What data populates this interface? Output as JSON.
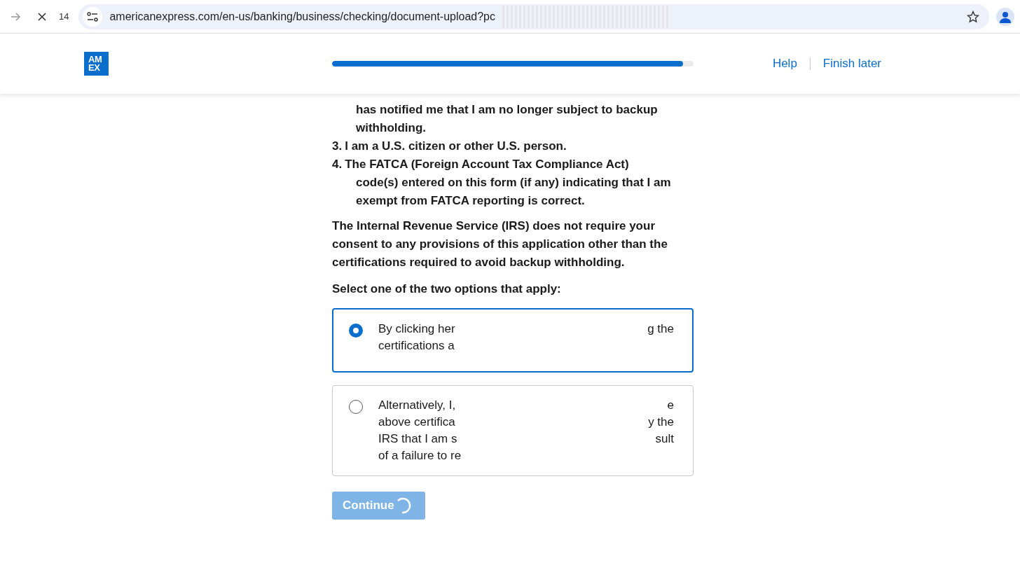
{
  "browser": {
    "tab_count": "14",
    "url": "americanexpress.com/en-us/banking/business/checking/document-upload?pc",
    "bookmarked": false
  },
  "header": {
    "logo": [
      "AM",
      "EX"
    ],
    "progress": {
      "level": 0.97
    },
    "links": [
      {
        "label": "Help"
      },
      {
        "label": "Finish later"
      }
    ]
  },
  "certifications": [
    {
      "text": "has notified me that I am no longer subject to backup withholding."
    },
    {
      "number": "3.",
      "text": "I am a U.S. citizen or other U.S. person."
    },
    {
      "number": "4.",
      "text": "The FATCA (Foreign Account Tax Compliance Act) code(s) entered on this form (if any) indicating that I am exempt from FATCA reporting is correct."
    }
  ],
  "irs_note": "The Internal Revenue Service (IRS) does not require your consent to any provisions of this application other than the certifications required to avoid backup withholding.",
  "prompt": "Select one of the two options that apply:",
  "options": [
    {
      "selected": true,
      "lines": [
        {
          "left": "By clicking her",
          "right": "g the"
        },
        {
          "left": "certifications a"
        }
      ]
    },
    {
      "selected": false,
      "lines": [
        {
          "left": "Alternatively, I,",
          "right": "e"
        },
        {
          "left": "above certifica",
          "right": "y the"
        },
        {
          "left": "IRS that I am s",
          "right": "sult"
        },
        {
          "left": "of a failure to re"
        }
      ]
    }
  ],
  "continue_button": {
    "label": "Continue",
    "loading": true
  }
}
